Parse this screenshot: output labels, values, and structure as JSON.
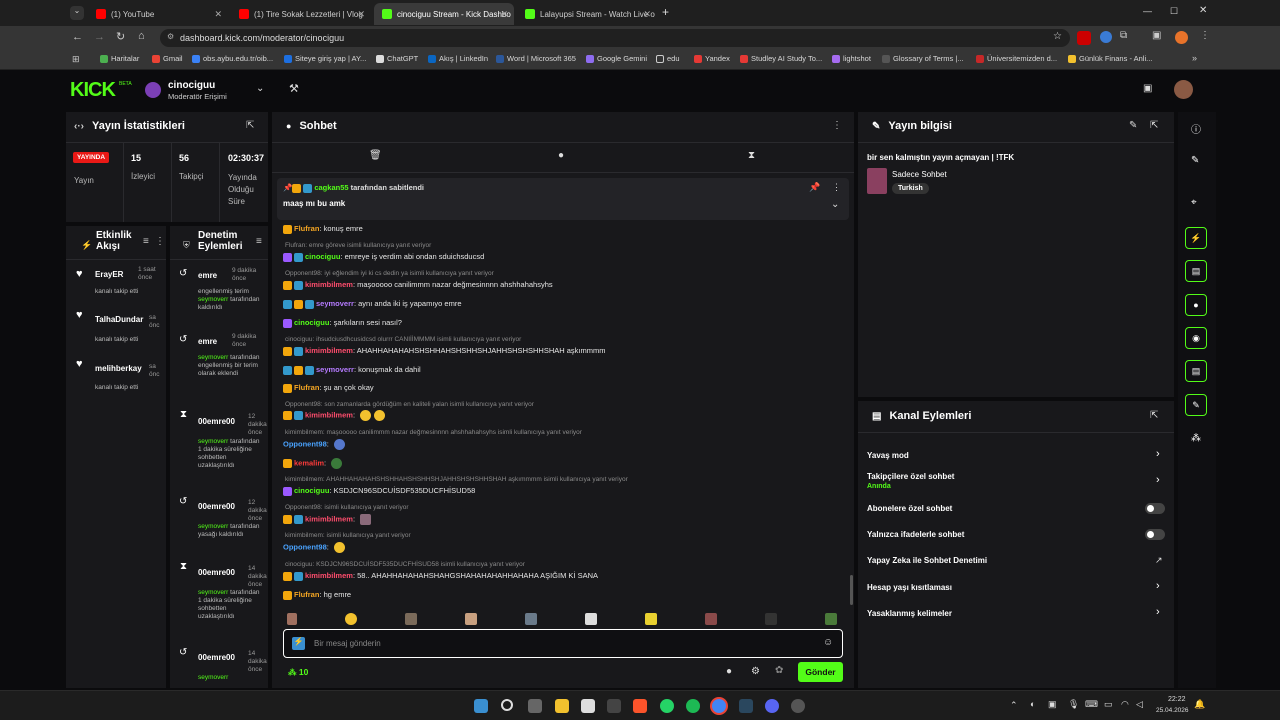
{
  "browser": {
    "tabs": [
      {
        "label": "(1) YouTube"
      },
      {
        "label": "(1) Tire Sokak Lezzetleri | Vlog"
      },
      {
        "label": "cinociguu Stream - Kick Dashbo"
      },
      {
        "label": "Lalayupsi Stream - Watch Live o"
      }
    ],
    "url": "dashboard.kick.com/moderator/cinociguu",
    "bookmarks": [
      "Haritalar",
      "Gmail",
      "obs.aybu.edu.tr/oib...",
      "Siteye giriş yap | AY...",
      "ChatGPT",
      "Akış | LinkedIn",
      "Word | Microsoft 365",
      "Google Gemini",
      "edu",
      "Yandex",
      "Studley AI Study To...",
      "lightshot",
      "Glossary of Terms |...",
      "Üniversitemizden d...",
      "Günlük Finans - Anli..."
    ]
  },
  "header": {
    "logo": "KICK",
    "beta": "BETA",
    "channel": "cinociguu",
    "role": "Moderatör Erişimi"
  },
  "stats": {
    "title": "Yayın İstatistikleri",
    "live_badge": "YAYINDA",
    "live_label": "Yayın",
    "viewers": "15",
    "viewers_label": "İzleyici",
    "followers": "56",
    "followers_label": "Takipçi",
    "uptime": "02:30:37",
    "uptime_label": "Yayında Olduğu Süre"
  },
  "activity": {
    "title": "Etkinlik Akışı",
    "items": [
      {
        "name": "ErayER",
        "time": "1 saat önce",
        "sub": "kanalı takip etti"
      },
      {
        "name": "TalhaDundar",
        "time": "sa önc",
        "sub": "kanalı takip etti"
      },
      {
        "name": "melihberkay",
        "time": "sa önc",
        "sub": "kanalı takip etti"
      }
    ]
  },
  "moderation": {
    "title": "Denetim Eylemleri",
    "items": [
      {
        "name": "emre",
        "time": "9 dakika önce",
        "sub": "engellenmiş terim",
        "mod": "seymoverr",
        "rest": "tarafından kaldırıldı"
      },
      {
        "name": "emre",
        "time": "9 dakika önce",
        "mod": "seymoverr",
        "rest": "tarafından engellenmiş bir terim olarak eklendi"
      },
      {
        "name": "00emre00",
        "time": "12 dakika önce",
        "mod": "seymoverr",
        "rest": "tarafından 1 dakika süreliğine sohbetten uzaklaştırıldı"
      },
      {
        "name": "00emre00",
        "time": "12 dakika önce",
        "mod": "seymoverr",
        "rest": "tarafından yasağı kaldırıldı"
      },
      {
        "name": "00emre00",
        "time": "14 dakika önce",
        "mod": "seymoverr",
        "rest": "tarafından 1 dakika süreliğine sohbetten uzaklaştırıldı"
      },
      {
        "name": "00emre00",
        "time": "14 dakika önce",
        "mod": "seymoverr",
        "rest": ""
      }
    ]
  },
  "chat": {
    "title": "Sohbet",
    "pinned": {
      "user": "cagkan55",
      "by": "tarafından sabitlendi",
      "text": "maaş mı bu amk"
    },
    "lines": [
      {
        "reply": "",
        "user": "Flufran",
        "color": "#f5a623",
        "text": "konuş emre"
      },
      {
        "reply": "Flufran: emre göreve isimli kullanıcıya yanıt veriyor",
        "user": "cinociguu",
        "color": "#53fc18",
        "text": "emreye iş verdim abi ondan sduichsducsd"
      },
      {
        "reply": "Opponent98: iyi eğlendim iyi ki cs dedin ya isimli kullanıcıya yanıt veriyor",
        "user": "kimimbilmem",
        "color": "#ff4d6d",
        "text": "maşooooo canilimmm nazar değmesinnnn ahshhahahsyhs"
      },
      {
        "reply": "",
        "user": "seymoverr",
        "color": "#b57bff",
        "text": "aynı anda iki iş yapamıyo emre"
      },
      {
        "reply": "",
        "user": "cinociguu",
        "color": "#53fc18",
        "text": "şarkıların sesi nasıl?"
      },
      {
        "reply": "cinociguu: ihsudciusdhcusidcsd olurrr CANIİİMMMM isimli kullanıcıya yanıt veriyor",
        "user": "kimimbilmem",
        "color": "#ff4d6d",
        "text": "AHAHHAHAHAHSHSHHAHSHSHHSHJAHHSHSHSHHSHAH aşkımmmm"
      },
      {
        "reply": "",
        "user": "seymoverr",
        "color": "#b57bff",
        "text": "konuşmak da dahil"
      },
      {
        "reply": "",
        "user": "Flufran",
        "color": "#f5a623",
        "text": "şu an çok okay"
      },
      {
        "reply": "Opponent98: son zamanlarda gördüğüm en kaliteli yalan isimli kullanıcıya yanıt veriyor",
        "user": "kimimbilmem",
        "color": "#ff4d6d",
        "text": ""
      },
      {
        "reply": "kimimbilmem: maşooooo canilimmm nazar değmesinnnn ahshhahahsyhs isimli kullanıcıya yanıt veriyor",
        "user": "Opponent98",
        "color": "#4aa3ff",
        "text": ""
      },
      {
        "reply": "",
        "user": "kemalim",
        "color": "#ff3b3b",
        "text": ""
      },
      {
        "reply": "kimimbilmem: AHAHHAHAHAHSHSHHAHSHSHHSHJAHHSHSHSHHSHAH aşkımmmm isimli kullanıcıya yanıt veriyor",
        "user": "cinociguu",
        "color": "#53fc18",
        "text": "KSDJCN96SDCUİSDF535DUCFHİSUD58"
      },
      {
        "reply": "Opponent98: isimli kullanıcıya yanıt veriyor",
        "user": "kimimbilmem",
        "color": "#ff4d6d",
        "text": ""
      },
      {
        "reply": "kimimbilmem: isimli kullanıcıya yanıt veriyor",
        "user": "Opponent98",
        "color": "#4aa3ff",
        "text": ""
      },
      {
        "reply": "cinociguu: KSDJCN96SDCUİSDF535DUCFHİSUD58 isimli kullanıcıya yanıt veriyor",
        "user": "kimimbilmem",
        "color": "#ff4d6d",
        "text": "58.. AHAHHAHAHAHSHAHGSHAHAHAHAHHAHAHA AŞIĞIM Kİ SANA"
      },
      {
        "reply": "",
        "user": "Flufran",
        "color": "#f5a623",
        "text": "hg emre"
      }
    ],
    "placeholder": "Bir mesaj gönderin",
    "count": "10",
    "send": "Gönder"
  },
  "info": {
    "title": "Yayın bilgisi",
    "stream_title": "bir sen kalmıştın yayın açmayan | !TFK",
    "category": "Sadece Sohbet",
    "tag": "Turkish"
  },
  "actions": {
    "title": "Kanal Eylemleri",
    "items": [
      {
        "label": "Yavaş mod",
        "sub": "",
        "type": "chevron"
      },
      {
        "label": "Takipçilere özel sohbet",
        "sub": "Anında",
        "type": "chevron"
      },
      {
        "label": "Abonelere özel sohbet",
        "sub": "",
        "type": "toggle"
      },
      {
        "label": "Yalnızca ifadelerle sohbet",
        "sub": "",
        "type": "toggle"
      },
      {
        "label": "Yapay Zeka ile Sohbet Denetimi",
        "sub": "",
        "type": "external"
      },
      {
        "label": "Hesap yaşı kısıtlaması",
        "sub": "",
        "type": "chevron"
      },
      {
        "label": "Yasaklanmış kelimeler",
        "sub": "",
        "type": "chevron"
      }
    ]
  },
  "taskbar": {
    "time": "22:22",
    "date": "25.04.2026"
  },
  "colors": {
    "accent": "#53fc18",
    "panel": "#18181b",
    "bg": "#0b0b0d"
  }
}
